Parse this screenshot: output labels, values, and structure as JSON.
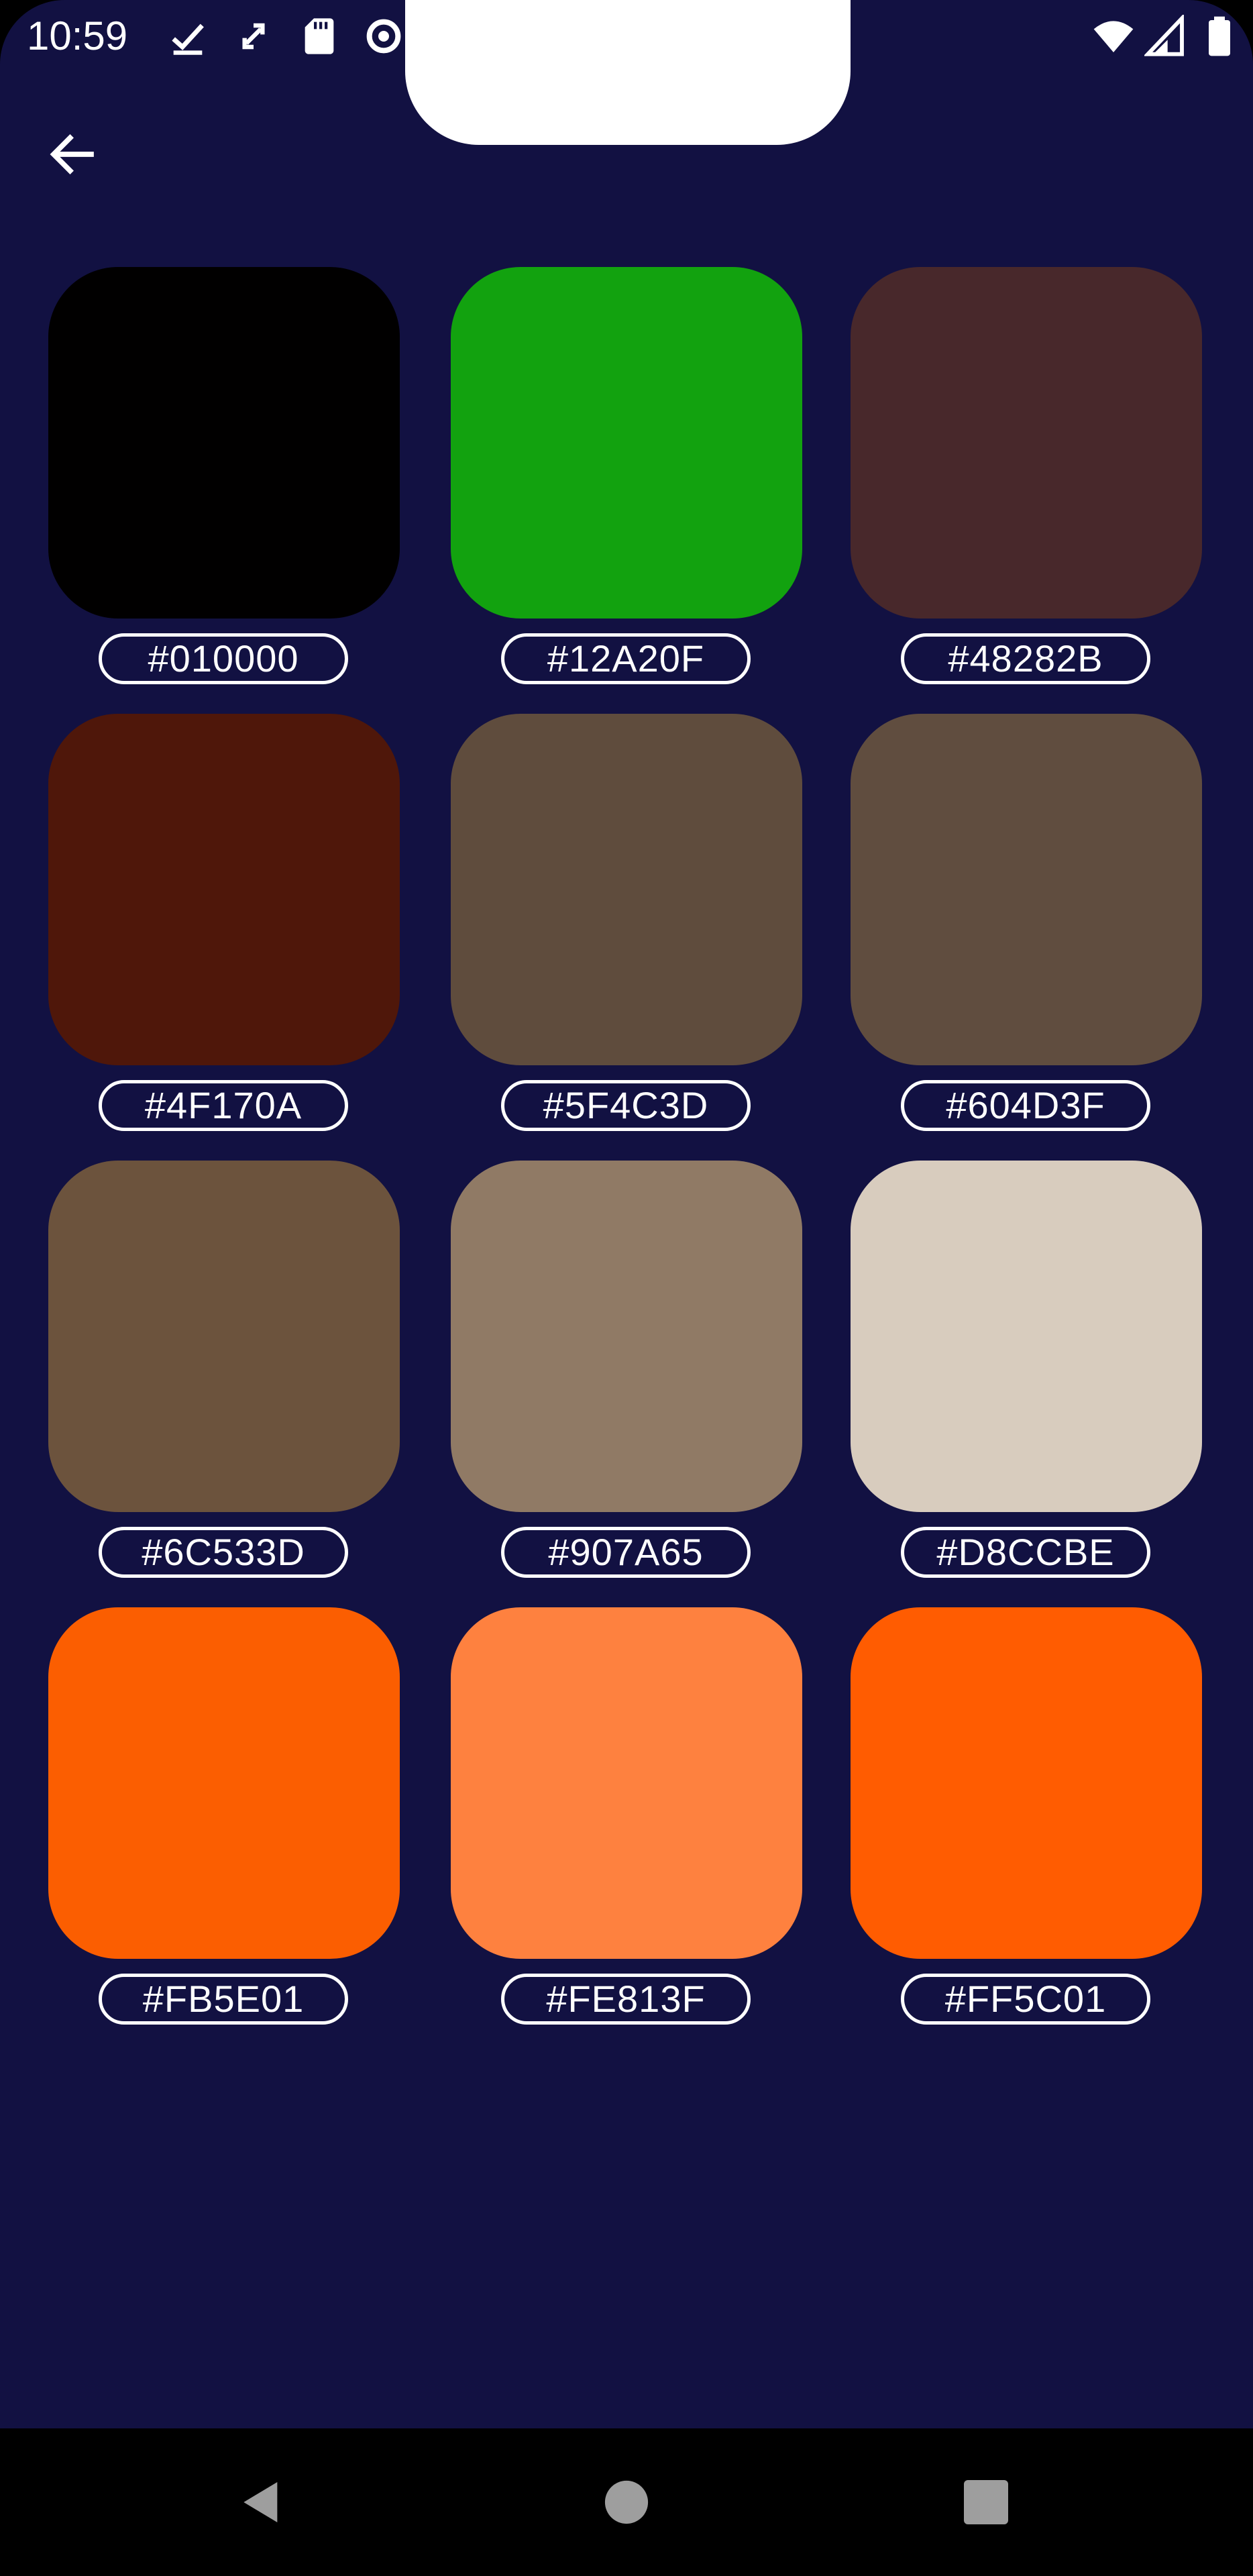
{
  "status_bar": {
    "time": "10:59",
    "left_icons": [
      "download-done-icon",
      "sync-icon",
      "sd-card-icon",
      "data-saver-icon"
    ],
    "right_icons": [
      "wifi-icon",
      "cell-signal-icon",
      "battery-icon"
    ]
  },
  "app_bar": {
    "back_icon": "arrow-back-icon"
  },
  "palette": {
    "label_color": "#FFFFFF",
    "background_color": "#121142",
    "swatches": [
      {
        "hex": "#010000",
        "color": "#010000"
      },
      {
        "hex": "#12A20F",
        "color": "#12A20F"
      },
      {
        "hex": "#48282B",
        "color": "#48282B"
      },
      {
        "hex": "#4F170A",
        "color": "#4F170A"
      },
      {
        "hex": "#5F4C3D",
        "color": "#5F4C3D"
      },
      {
        "hex": "#604D3F",
        "color": "#604D3F"
      },
      {
        "hex": "#6C533D",
        "color": "#6C533D"
      },
      {
        "hex": "#907A65",
        "color": "#907A65"
      },
      {
        "hex": "#D8CCBE",
        "color": "#D8CCBE"
      },
      {
        "hex": "#FB5E01",
        "color": "#FB5E01"
      },
      {
        "hex": "#FE813F",
        "color": "#FE813F"
      },
      {
        "hex": "#FF5C01",
        "color": "#FF5C01"
      }
    ]
  },
  "nav_bar": {
    "buttons": [
      "back-triangle-icon",
      "home-circle-icon",
      "recents-square-icon"
    ]
  }
}
